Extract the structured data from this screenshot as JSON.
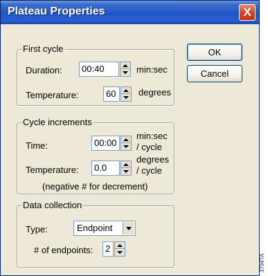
{
  "window": {
    "title": "Plateau Properties",
    "close_glyph": "X"
  },
  "buttons": {
    "ok": "OK",
    "cancel": "Cancel"
  },
  "first_cycle": {
    "legend": "First cycle",
    "duration_label": "Duration:",
    "duration_value": "00:40",
    "duration_unit": "min:sec",
    "temperature_label": "Temperature:",
    "temperature_value": "60",
    "temperature_unit": "degrees"
  },
  "cycle_increments": {
    "legend": "Cycle increments",
    "time_label": "Time:",
    "time_value": "00:00",
    "time_unit_line1": "min:sec",
    "time_unit_line2": "/ cycle",
    "temperature_label": "Temperature:",
    "temperature_value": "0.0",
    "temperature_unit_line1": "degrees",
    "temperature_unit_line2": "/ cycle",
    "note": "(negative # for decrement)"
  },
  "data_collection": {
    "legend": "Data collection",
    "type_label": "Type:",
    "type_value": "Endpoint",
    "endpoints_label": "# of endpoints:",
    "endpoints_value": "2"
  },
  "side_code": "3794TA"
}
